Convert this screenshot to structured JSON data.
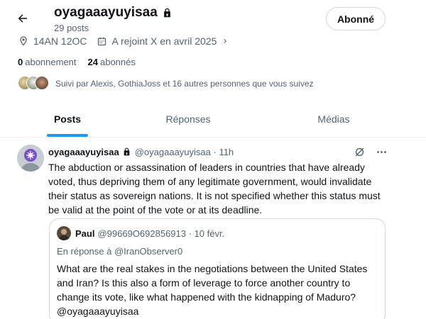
{
  "profile": {
    "name": "oyagaaayuyisaa",
    "post_count": "29 posts",
    "follow_button": "Abonné",
    "location": "14AN 12OC",
    "joined": "A rejoint X en avril 2025",
    "following_count": "0",
    "following_label": "abonnement",
    "followers_count": "24",
    "followers_label": "abonnés",
    "followed_by": "Suivi par Alexis, GothiaJoss et 16 autres personnes que vous suivez"
  },
  "tabs": [
    {
      "label": "Posts",
      "active": true
    },
    {
      "label": "Réponses",
      "active": false
    },
    {
      "label": "Médias",
      "active": false
    }
  ],
  "tweet": {
    "author": "oyagaaayuyisaa",
    "handle_time": "@oyagaaayuyisaa · 11h",
    "text": "The abduction or assassination of leaders in countries that have already voted, thus depriving them of any legitimate government, would invalidate their status as sovereign nations. It is not specified whether this status must be valid at the point of the vote or at its deadline."
  },
  "quoted_tweet": {
    "author": "Paul",
    "handle_date": "@99669O692856913 · 10 févr.",
    "reply_prefix": "En réponse à ",
    "reply_handle": "@IranObserver0",
    "text": "What are the real stakes in the negotiations between the United States and Iran? Is this also a form of leverage to force another country to change its vote, like what happened with the kidnapping of Maduro? @oyagaaayuyisaa"
  },
  "icons": {
    "back": "arrow-left-icon",
    "lock": "lock-icon",
    "location": "location-pin-icon",
    "calendar": "calendar-icon",
    "chevron": "chevron-right-icon",
    "grok": "grok-icon",
    "more": "more-icon"
  },
  "colors": {
    "accent": "#1d9bf0",
    "text_primary": "#0f1419",
    "text_secondary": "#536471",
    "border": "#cfd9de"
  }
}
